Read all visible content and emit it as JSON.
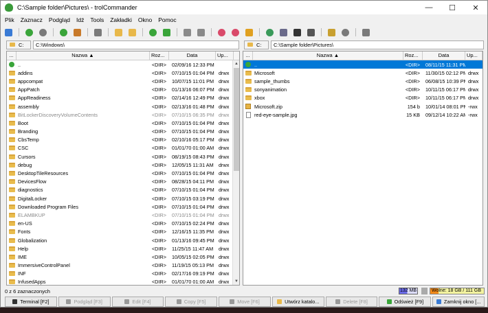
{
  "window": {
    "title": "C:\\Sample folder\\Pictures\\ - trolCommander",
    "minimize": "—",
    "maximize": "☐",
    "close": "✕"
  },
  "menu": [
    "Plik",
    "Zaznacz",
    "Podgląd",
    "Idź",
    "Tools",
    "Zakładki",
    "Okno",
    "Pomoc"
  ],
  "toolbar_icons": [
    {
      "name": "new-window-icon",
      "color": "#3a7bd5"
    },
    {
      "name": "sep"
    },
    {
      "name": "go-back-icon",
      "color": "#3aa53a"
    },
    {
      "name": "stop-icon",
      "color": "#7a7a7a"
    },
    {
      "name": "sep"
    },
    {
      "name": "go-parent-icon",
      "color": "#3aa53a"
    },
    {
      "name": "home-icon",
      "color": "#c87a2a"
    },
    {
      "name": "sep"
    },
    {
      "name": "cancel-icon",
      "color": "#7a7a7a"
    },
    {
      "name": "sep"
    },
    {
      "name": "folder-add-icon",
      "color": "#e8b84a"
    },
    {
      "name": "folder-remove-icon",
      "color": "#e8b84a"
    },
    {
      "name": "sep"
    },
    {
      "name": "refresh-icon",
      "color": "#3aa53a"
    },
    {
      "name": "swap-icon",
      "color": "#3aa53a"
    },
    {
      "name": "sep"
    },
    {
      "name": "pack-icon",
      "color": "#8a8a8a"
    },
    {
      "name": "unpack-icon",
      "color": "#8a8a8a"
    },
    {
      "name": "sep"
    },
    {
      "name": "bookmark-add-icon",
      "color": "#d94a6a"
    },
    {
      "name": "bookmark-icon",
      "color": "#d94a6a"
    },
    {
      "name": "key-icon",
      "color": "#e0a020"
    },
    {
      "name": "sep"
    },
    {
      "name": "network-icon",
      "color": "#3a9a5a"
    },
    {
      "name": "connect-icon",
      "color": "#6a6a8a"
    },
    {
      "name": "terminal-icon",
      "color": "#333"
    },
    {
      "name": "comment-icon",
      "color": "#555"
    },
    {
      "name": "sep"
    },
    {
      "name": "tools-icon",
      "color": "#c8a030"
    },
    {
      "name": "stop-circle-icon",
      "color": "#7a7a7a"
    },
    {
      "name": "sep"
    },
    {
      "name": "settings-gear-icon",
      "color": "#7a7a7a"
    }
  ],
  "left": {
    "drive": "C:",
    "path": "C:\\Windows\\",
    "headers": {
      "ext": "...",
      "name": "Nazwa ▲",
      "size": "Roz...",
      "date": "Data",
      "perm": "Up..."
    },
    "rows": [
      {
        "icon": "up",
        "name": "..",
        "size": "<DIR>",
        "date": "02/09/16 12:33 PM",
        "perm": ""
      },
      {
        "icon": "folder",
        "name": "addins",
        "size": "<DIR>",
        "date": "07/10/15 01:04 PM",
        "perm": "drwx"
      },
      {
        "icon": "folder",
        "name": "appcompat",
        "size": "<DIR>",
        "date": "10/07/15 11:01 PM",
        "perm": "drwx"
      },
      {
        "icon": "folder",
        "name": "AppPatch",
        "size": "<DIR>",
        "date": "01/13/16 06:07 PM",
        "perm": "drwx"
      },
      {
        "icon": "folder",
        "name": "AppReadiness",
        "size": "<DIR>",
        "date": "02/14/16 12:49 PM",
        "perm": "drwx"
      },
      {
        "icon": "folder",
        "name": "assembly",
        "size": "<DIR>",
        "date": "02/13/16 01:48 PM",
        "perm": "drwx"
      },
      {
        "icon": "folder",
        "name": "BitLockerDiscoveryVolumeContents",
        "size": "<DIR>",
        "date": "07/10/15 06:35 PM",
        "perm": "drwx",
        "grey": true
      },
      {
        "icon": "folder",
        "name": "Boot",
        "size": "<DIR>",
        "date": "07/10/15 01:04 PM",
        "perm": "drwx"
      },
      {
        "icon": "folder",
        "name": "Branding",
        "size": "<DIR>",
        "date": "07/10/15 01:04 PM",
        "perm": "drwx"
      },
      {
        "icon": "folder",
        "name": "CbsTemp",
        "size": "<DIR>",
        "date": "02/10/16 05:17 PM",
        "perm": "drwx"
      },
      {
        "icon": "folder",
        "name": "CSC",
        "size": "<DIR>",
        "date": "01/01/70 01:00 AM",
        "perm": "drwx"
      },
      {
        "icon": "folder",
        "name": "Cursors",
        "size": "<DIR>",
        "date": "08/19/15 08:43 PM",
        "perm": "drwx"
      },
      {
        "icon": "folder",
        "name": "debug",
        "size": "<DIR>",
        "date": "12/05/15 11:31 AM",
        "perm": "drwx"
      },
      {
        "icon": "folder",
        "name": "DesktopTileResources",
        "size": "<DIR>",
        "date": "07/10/15 01:04 PM",
        "perm": "drwx"
      },
      {
        "icon": "folder",
        "name": "DevicesFlow",
        "size": "<DIR>",
        "date": "08/28/15 04:11 PM",
        "perm": "drwx"
      },
      {
        "icon": "folder",
        "name": "diagnostics",
        "size": "<DIR>",
        "date": "07/10/15 01:04 PM",
        "perm": "drwx"
      },
      {
        "icon": "folder",
        "name": "DigitalLocker",
        "size": "<DIR>",
        "date": "07/10/15 03:19 PM",
        "perm": "drwx"
      },
      {
        "icon": "folder",
        "name": "Downloaded Program Files",
        "size": "<DIR>",
        "date": "07/10/15 01:04 PM",
        "perm": "drwx"
      },
      {
        "icon": "folder",
        "name": "ELAMBKUP",
        "size": "<DIR>",
        "date": "07/10/15 01:04 PM",
        "perm": "drwx",
        "grey": true
      },
      {
        "icon": "folder",
        "name": "en-US",
        "size": "<DIR>",
        "date": "07/10/15 02:24 PM",
        "perm": "drwx"
      },
      {
        "icon": "folder",
        "name": "Fonts",
        "size": "<DIR>",
        "date": "12/16/15 11:35 PM",
        "perm": "drwx"
      },
      {
        "icon": "folder",
        "name": "Globalization",
        "size": "<DIR>",
        "date": "01/13/16 09:45 PM",
        "perm": "drwx"
      },
      {
        "icon": "folder",
        "name": "Help",
        "size": "<DIR>",
        "date": "11/25/15 11:47 AM",
        "perm": "drwx"
      },
      {
        "icon": "folder",
        "name": "IME",
        "size": "<DIR>",
        "date": "10/05/15 02:05 PM",
        "perm": "drwx"
      },
      {
        "icon": "folder",
        "name": "ImmersiveControlPanel",
        "size": "<DIR>",
        "date": "11/19/15 05:13 PM",
        "perm": "drwx"
      },
      {
        "icon": "folder",
        "name": "INF",
        "size": "<DIR>",
        "date": "02/17/16 09:19 PM",
        "perm": "drwx"
      },
      {
        "icon": "folder",
        "name": "InfusedApps",
        "size": "<DIR>",
        "date": "01/01/70 01:00 AM",
        "perm": "drwx"
      }
    ]
  },
  "right": {
    "drive": "C:",
    "path": "C:\\Sample folder\\Pictures\\",
    "headers": {
      "ext": "...",
      "name": "Nazwa ▲",
      "size": "Roz...",
      "date": "Data",
      "perm": "Up..."
    },
    "rows": [
      {
        "icon": "up",
        "name": "..",
        "size": "<DIR>",
        "date": "08/11/15 11:31 PM",
        "perm": "",
        "selected": true
      },
      {
        "icon": "folder",
        "name": "Microsoft",
        "size": "<DIR>",
        "date": "11/30/15 02:12 PM",
        "perm": "drwx"
      },
      {
        "icon": "folder",
        "name": "sample_thumbs",
        "size": "<DIR>",
        "date": "06/08/15 10:39 PM",
        "perm": "drwx"
      },
      {
        "icon": "folder",
        "name": "sonyanimation",
        "size": "<DIR>",
        "date": "10/11/15 06:17 PM",
        "perm": "drwx"
      },
      {
        "icon": "folder",
        "name": "xbox",
        "size": "<DIR>",
        "date": "10/11/15 06:17 PM",
        "perm": "drwx"
      },
      {
        "icon": "zip",
        "name": "Microsoft.zip",
        "size": "154 b",
        "date": "10/01/14 08:01 PM",
        "perm": "-rwx"
      },
      {
        "icon": "file",
        "name": "red-eye-sample.jpg",
        "size": "15 KB",
        "date": "09/12/14 10:22 AM",
        "perm": "-rwx"
      }
    ]
  },
  "status": {
    "text": "0 z 6 zaznaczonych",
    "memory": "132 MB",
    "memory_fraction": 0.45,
    "free": "Wolne: 18 GB / 111 GB",
    "free_fraction": 0.16
  },
  "fnkeys": [
    {
      "label": "Terminal [F2]",
      "enabled": true,
      "color": "#333",
      "name": "terminal"
    },
    {
      "label": "Podgląd [F3]",
      "enabled": false,
      "color": "#999",
      "name": "view"
    },
    {
      "label": "Edit [F4]",
      "enabled": false,
      "color": "#999",
      "name": "edit"
    },
    {
      "label": "Copy [F5]",
      "enabled": false,
      "color": "#999",
      "name": "copy"
    },
    {
      "label": "Move [F6]",
      "enabled": false,
      "color": "#999",
      "name": "move"
    },
    {
      "label": "Utwórz katalo...",
      "enabled": true,
      "color": "#e8b84a",
      "name": "mkdir"
    },
    {
      "label": "Delete [F8]",
      "enabled": false,
      "color": "#999",
      "name": "delete"
    },
    {
      "label": "Odśwież [F9]",
      "enabled": true,
      "color": "#3aa53a",
      "name": "refresh"
    },
    {
      "label": "Zamknij okno [...",
      "enabled": true,
      "color": "#3a7bd5",
      "name": "close-window"
    }
  ]
}
